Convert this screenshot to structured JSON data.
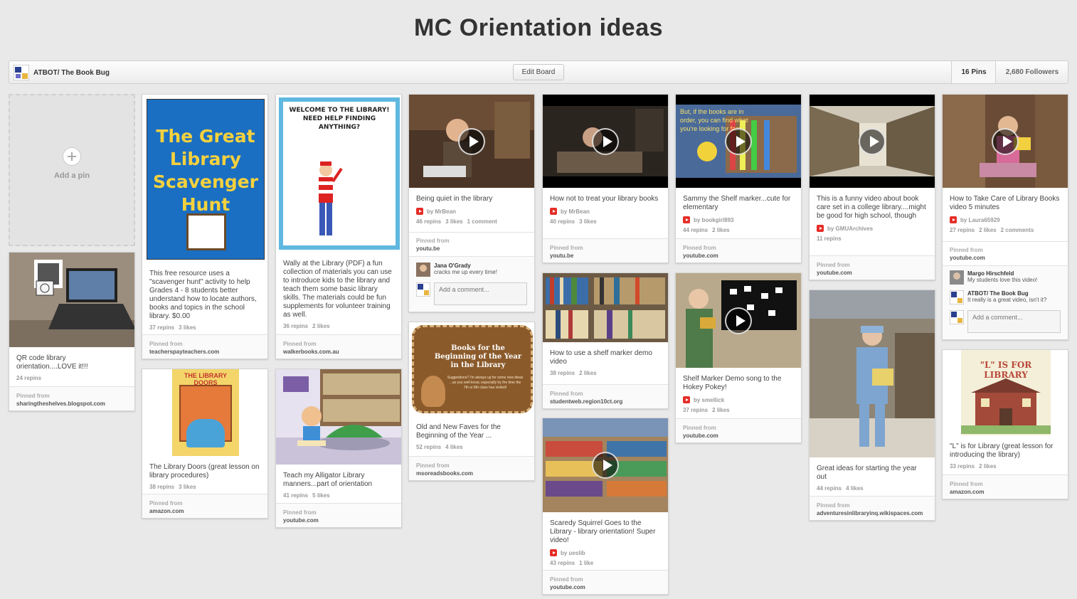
{
  "board": {
    "title": "MC Orientation ideas",
    "owner": "ATBOT/ The Book Bug",
    "edit_label": "Edit Board",
    "pins_count": "16 Pins",
    "followers_count": "2,680 Followers"
  },
  "add_pin": {
    "label": "Add a pin"
  },
  "labels": {
    "pinned_from": "Pinned from",
    "add_comment": "Add a comment..."
  },
  "pins": {
    "qr": {
      "desc": "QR code library orientation....LOVE it!!!",
      "repins": "24 repins",
      "source": "sharingtheshelves.blogspot.com"
    },
    "scavenger": {
      "desc": "This free resource uses a \"scavenger hunt\" activity to help Grades 4 - 8 students better understand how to locate authors, books and topics in the school library. $0.00",
      "repins": "37 repins",
      "likes": "3 likes",
      "source": "teacherspayteachers.com",
      "img_text": "The Great Library Scavenger Hunt"
    },
    "doors": {
      "desc": "The Library Doors (great lesson on library procedures)",
      "repins": "38 repins",
      "likes": "3 likes",
      "source": "amazon.com",
      "img_text": "THE LIBRARY DOORS"
    },
    "wally": {
      "desc": "Wally at the Library (PDF) a fun collection of materials you can use to introduce kids to the library and teach them some basic library skills. The materials could be fun supplements for volunteer training as well.",
      "repins": "36 repins",
      "likes": "2 likes",
      "source": "walkerbooks.com.au",
      "img_text": "WELCOME TO THE LIBRARY! NEED HELP FINDING ANYTHING?"
    },
    "alligator": {
      "desc": "Teach my Alligator Library manners...part of orientation",
      "repins": "41 repins",
      "likes": "5 likes",
      "source": "youtube.com"
    },
    "quiet": {
      "desc": "Being quiet in the library",
      "by": "by MrBean",
      "repins": "46 repins",
      "likes": "3 likes",
      "comments": "1 comment",
      "source": "youtu.be",
      "commenter": "Jana O'Grady",
      "comment": "cracks me up every time!"
    },
    "faves": {
      "desc": "Old and New Faves for the Beginning of the Year ...",
      "repins": "52 repins",
      "likes": "4 likes",
      "source": "msoreadsbooks.com",
      "img_text": "Books for the Beginning of the Year in the Library",
      "img_sub": "Suggestions? I'm always up for some new ideas ...as you well know, especially by the time the 7th or 8th class has visited!"
    },
    "treat": {
      "desc": "How not to treat your library books",
      "by": "by MrBean",
      "repins": "40 repins",
      "likes": "3 likes",
      "source": "youtu.be"
    },
    "shelfdemo": {
      "desc": "How to use a shelf marker demo video",
      "repins": "38 repins",
      "likes": "2 likes",
      "source": "studentweb.region10ct.org"
    },
    "squirrel": {
      "desc": "Scaredy Squirrel Goes to the Library - library orientation! Super video!",
      "by": "by ueslib",
      "repins": "43 repins",
      "likes": "1 like",
      "source": "youtube.com"
    },
    "sammy": {
      "desc": "Sammy the Shelf marker...cute for elementary",
      "by": "by bookgirl893",
      "repins": "44 repins",
      "likes": "2 likes",
      "source": "youtube.com",
      "img_text": "But, if the books are in order, you can find what you're looking for fast!"
    },
    "hokey": {
      "desc": "Shelf Marker Demo song to the Hokey Pokey!",
      "by": "by smellick",
      "repins": "37 repins",
      "likes": "2 likes",
      "source": "youtube.com"
    },
    "college": {
      "desc": "This is a funny video about book care set in a college library....might be good for high school, though",
      "by": "by GMUArchives",
      "repins": "11 repins",
      "source": "youtube.com"
    },
    "yearout": {
      "desc": "Great ideas for starting the year out",
      "repins": "44 repins",
      "likes": "4 likes",
      "source": "adventuresinlibraryinq.wikispaces.com"
    },
    "care": {
      "desc": "How to Take Care of Library Books video 5 minutes",
      "by": "by Laura65929",
      "repins": "27 repins",
      "likes": "2 likes",
      "comments": "2 comments",
      "source": "youtube.com",
      "c1_name": "Margo Hirschfeld",
      "c1_text": "My students love this video!",
      "c2_name": "ATBOT/ The Book Bug",
      "c2_text": "It really is a great video, isn't it?"
    },
    "lisfor": {
      "desc": "\"L\" is for Library (great lesson for introducing the library)",
      "repins": "33 repins",
      "likes": "2 likes",
      "source": "amazon.com",
      "img_text": "\"L\" IS FOR LIBRARY"
    }
  },
  "colors": {
    "background": "#e9e9e9",
    "youtube": "#e52d27"
  }
}
